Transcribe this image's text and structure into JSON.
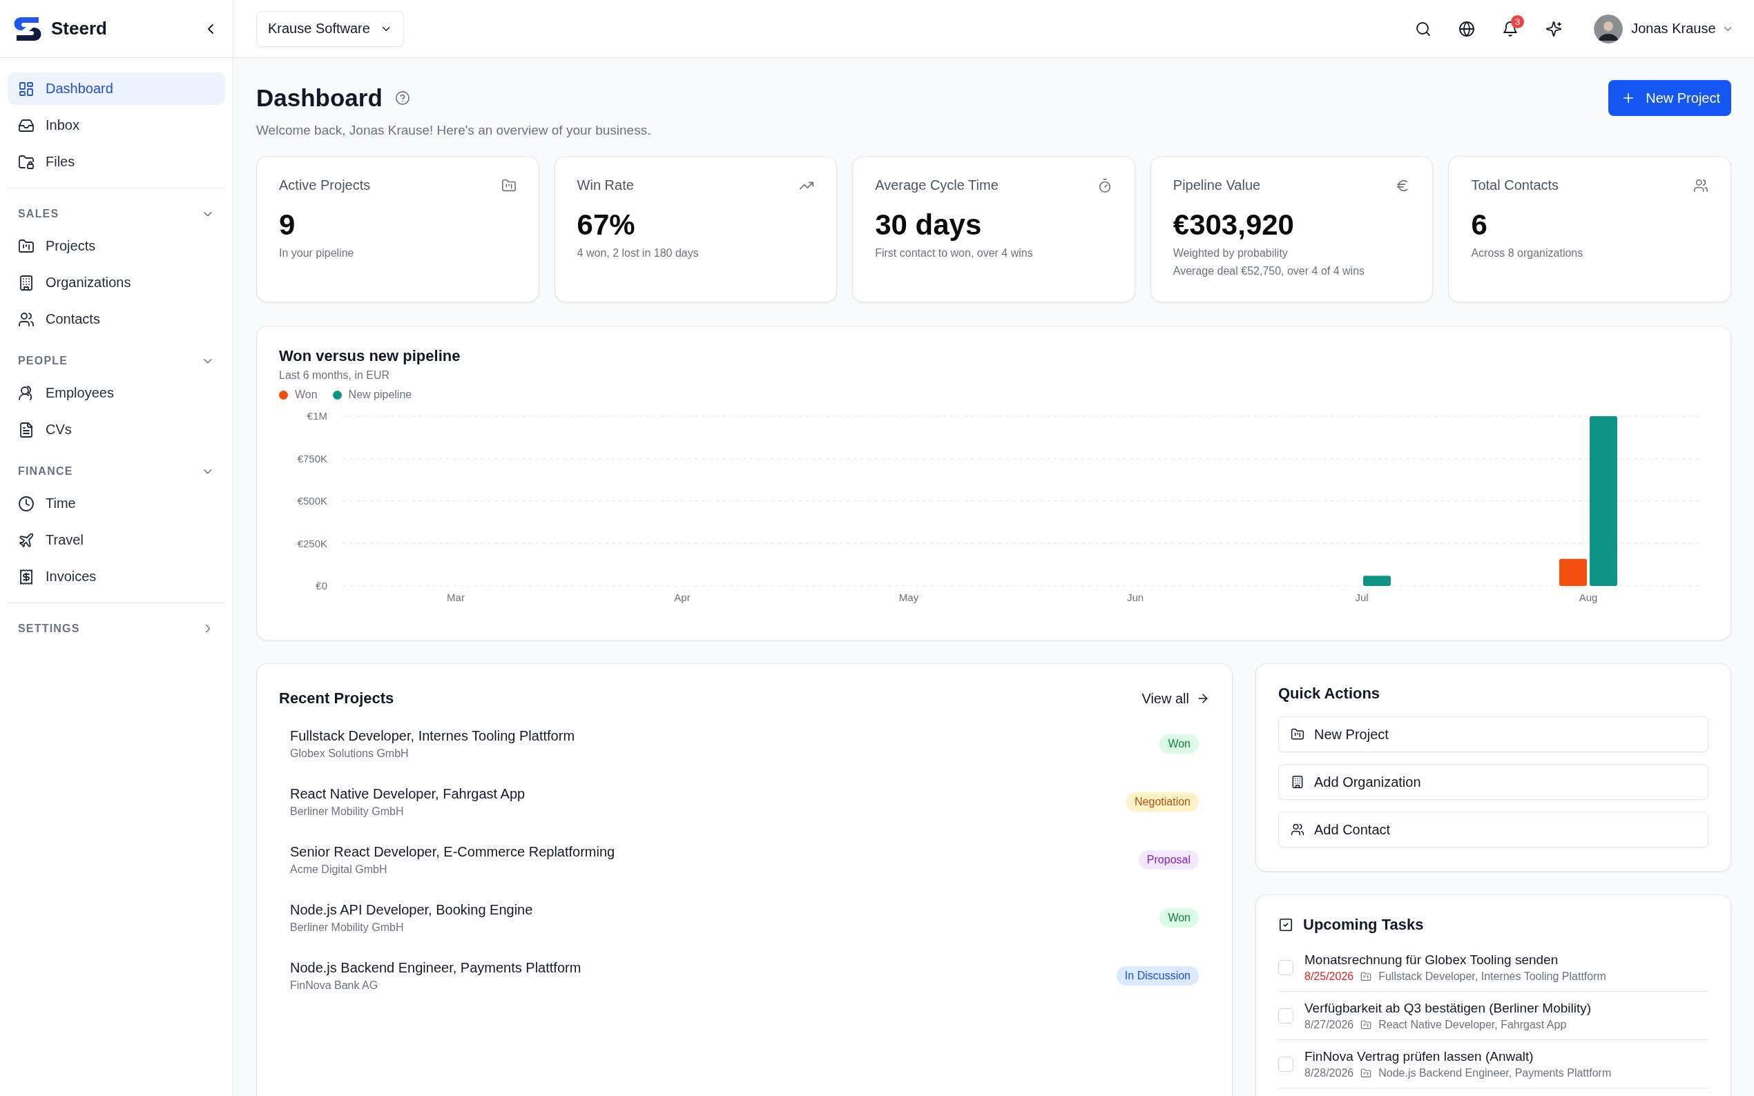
{
  "sidebar": {
    "brand": "Steerd",
    "nav": [
      {
        "label": "Dashboard",
        "selected": true
      },
      {
        "label": "Inbox",
        "selected": false
      },
      {
        "label": "Files",
        "selected": false
      }
    ],
    "sections": [
      {
        "title": "SALES",
        "expanded": true,
        "items": [
          {
            "label": "Projects",
            "selected": false
          },
          {
            "label": "Organizations",
            "selected": false
          },
          {
            "label": "Contacts",
            "selected": false
          }
        ]
      },
      {
        "title": "PEOPLE",
        "expanded": true,
        "items": [
          {
            "label": "Employees",
            "selected": false
          },
          {
            "label": "CVs",
            "selected": false
          }
        ]
      },
      {
        "title": "FINANCE",
        "expanded": true,
        "items": [
          {
            "label": "Time",
            "selected": false
          },
          {
            "label": "Travel",
            "selected": false
          },
          {
            "label": "Invoices",
            "selected": false
          }
        ]
      },
      {
        "title": "SETTINGS",
        "expanded": false
      }
    ]
  },
  "topbar": {
    "workspace": "Krause Software",
    "notifications": "3",
    "user": "Jonas Krause"
  },
  "header": {
    "title": "Dashboard",
    "subtitle": "Welcome back, Jonas Krause! Here's an overview of your business.",
    "primary_action": "New Project"
  },
  "stats": [
    {
      "label": "Active Projects",
      "value": "9",
      "notes": [
        "In your pipeline"
      ]
    },
    {
      "label": "Win Rate",
      "value": "67%",
      "notes": [
        "4 won, 2 lost in 180 days"
      ]
    },
    {
      "label": "Average Cycle Time",
      "value": "30 days",
      "notes": [
        "First contact to won, over 4 wins"
      ]
    },
    {
      "label": "Pipeline Value",
      "value": "€303,920",
      "notes": [
        "Weighted by probability",
        "Average deal €52,750, over 4 of 4 wins"
      ]
    },
    {
      "label": "Total Contacts",
      "value": "6",
      "notes": [
        "Across 8 organizations"
      ]
    }
  ],
  "chart": {
    "title": "Won versus new pipeline",
    "subtitle": "Last 6 months, in EUR",
    "chart_data": {
      "type": "bar",
      "categories": [
        "Mar",
        "Apr",
        "May",
        "Jun",
        "Jul",
        "Aug"
      ],
      "series": [
        {
          "name": "Won",
          "color": "#f24e0c",
          "values": [
            0,
            0,
            0,
            0,
            0,
            160000
          ]
        },
        {
          "name": "New pipeline",
          "color": "#0e9384",
          "values": [
            0,
            0,
            0,
            0,
            60000,
            1000000
          ]
        }
      ],
      "ylim": [
        0,
        1000000
      ],
      "grid": true,
      "yticks": [
        {
          "value": 0,
          "label": "€0"
        },
        {
          "value": 250000,
          "label": "€250K"
        },
        {
          "value": 500000,
          "label": "€500K"
        },
        {
          "value": 750000,
          "label": "€750K"
        },
        {
          "value": 1000000,
          "label": "€1M"
        }
      ]
    }
  },
  "recent_projects": {
    "title": "Recent Projects",
    "link": "View all",
    "rows": [
      {
        "title": "Fullstack Developer, Internes Tooling Plattform",
        "org": "Globex Solutions GmbH",
        "status": "Won",
        "kind": "won"
      },
      {
        "title": "React Native Developer, Fahrgast App",
        "org": "Berliner Mobility GmbH",
        "status": "Negotiation",
        "kind": "negotiation"
      },
      {
        "title": "Senior React Developer, E-Commerce Replatforming",
        "org": "Acme Digital GmbH",
        "status": "Proposal",
        "kind": "proposal"
      },
      {
        "title": "Node.js API Developer, Booking Engine",
        "org": "Berliner Mobility GmbH",
        "status": "Won",
        "kind": "won"
      },
      {
        "title": "Node.js Backend Engineer, Payments Plattform",
        "org": "FinNova Bank AG",
        "status": "In Discussion",
        "kind": "discussion"
      }
    ]
  },
  "quick_actions": {
    "title": "Quick Actions",
    "actions": [
      "New Project",
      "Add Organization",
      "Add Contact"
    ]
  },
  "tasks": {
    "title": "Upcoming Tasks",
    "items": [
      {
        "title": "Monatsrechnung für Globex Tooling senden",
        "date": "8/25/2026",
        "overdue": true,
        "project": "Fullstack Developer, Internes Tooling Plattform",
        "checked": false
      },
      {
        "title": "Verfügbarkeit ab Q3 bestätigen (Berliner Mobility)",
        "date": "8/27/2026",
        "overdue": false,
        "project": "React Native Developer, Fahrgast App",
        "checked": false
      },
      {
        "title": "FinNova Vertrag prüfen lassen (Anwalt)",
        "date": "8/28/2026",
        "overdue": false,
        "project": "Node.js Backend Engineer, Payments Plattform",
        "checked": false
      }
    ]
  }
}
